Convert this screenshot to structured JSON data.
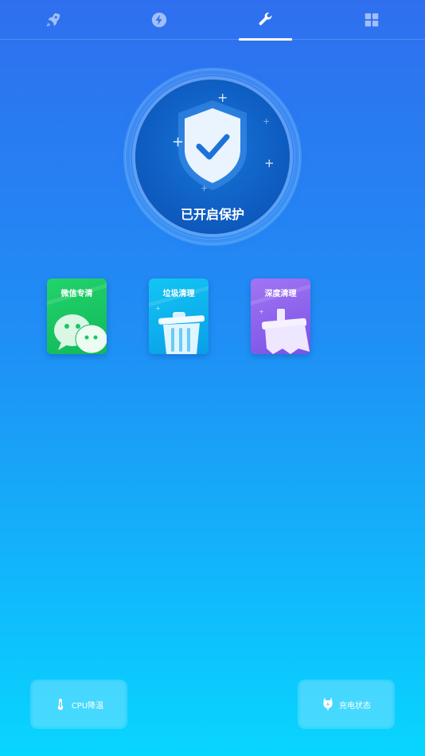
{
  "tabs": [
    {
      "icon": "rocket-icon",
      "active": false
    },
    {
      "icon": "lightning-icon",
      "active": false
    },
    {
      "icon": "wrench-icon",
      "active": true
    },
    {
      "icon": "grid-icon",
      "active": false
    }
  ],
  "protection": {
    "status_text": "已开启保护"
  },
  "tools": [
    {
      "label": "微信专清",
      "icon": "wechat-icon",
      "color": "#1fcd66"
    },
    {
      "label": "垃圾清理",
      "icon": "trash-can-icon",
      "color": "#0fb6f0"
    },
    {
      "label": "深度清理",
      "icon": "broom-icon",
      "color": "#8c63ef"
    }
  ],
  "bottom_buttons": {
    "cpu_cool": {
      "label": "CPU降温",
      "icon": "thermometer-icon"
    },
    "charge_status": {
      "label": "充电状态",
      "icon": "charger-plug-icon"
    }
  },
  "colors": {
    "accent": "#1f8ff5",
    "white": "#ffffff"
  }
}
